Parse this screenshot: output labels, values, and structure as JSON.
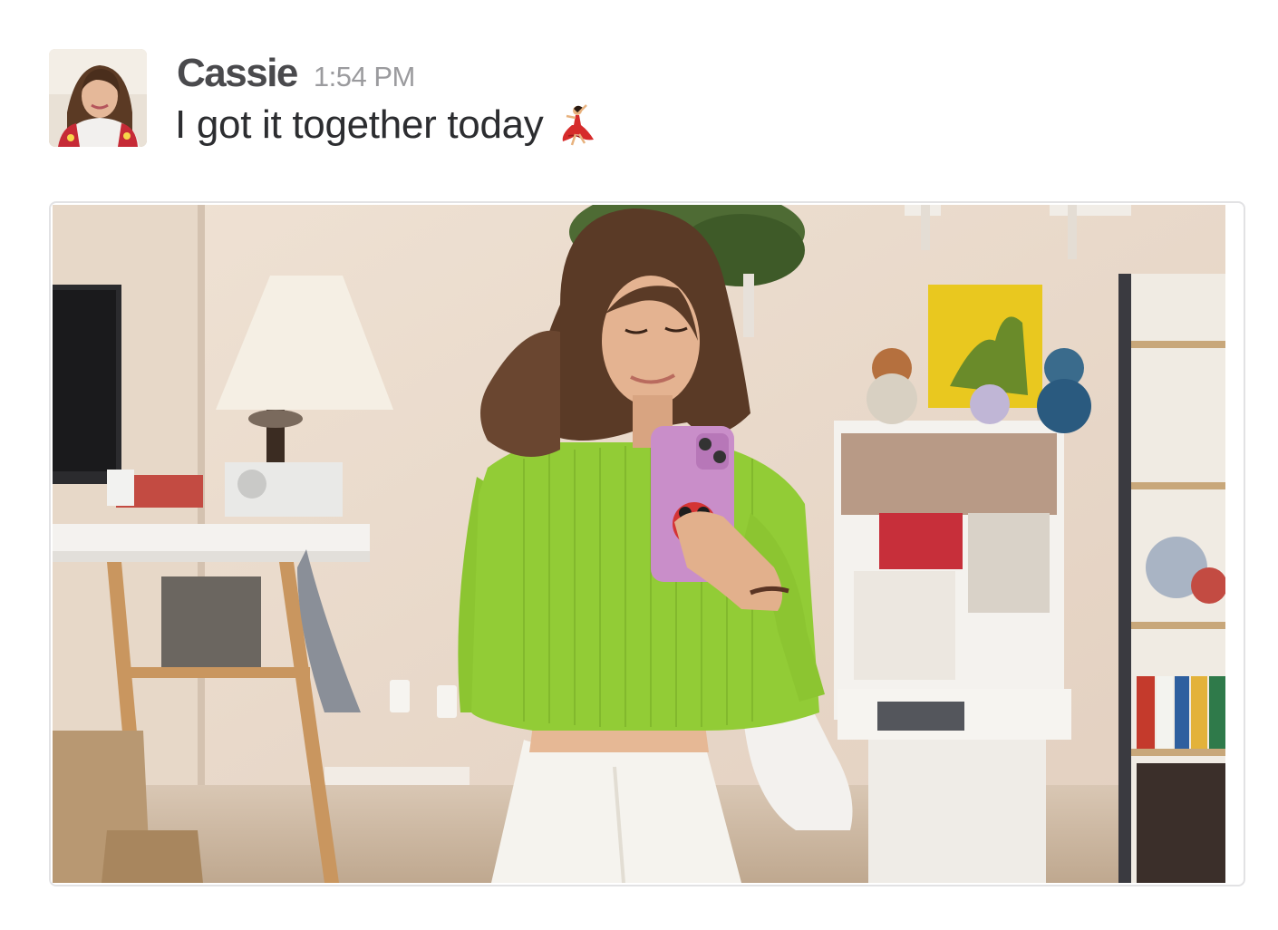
{
  "message": {
    "sender": "Cassie",
    "timestamp": "1:54 PM",
    "text": "I got it together today",
    "emoji": "dancer-emoji"
  },
  "avatar": {
    "icon": "user-avatar-photo"
  },
  "attachment": {
    "icon": "mirror-selfie-photo"
  },
  "colors": {
    "sender": "#4a4a4d",
    "timestamp": "#9b9b9e",
    "text": "#2c2d30",
    "attachment_border": "#e2e2e4"
  }
}
